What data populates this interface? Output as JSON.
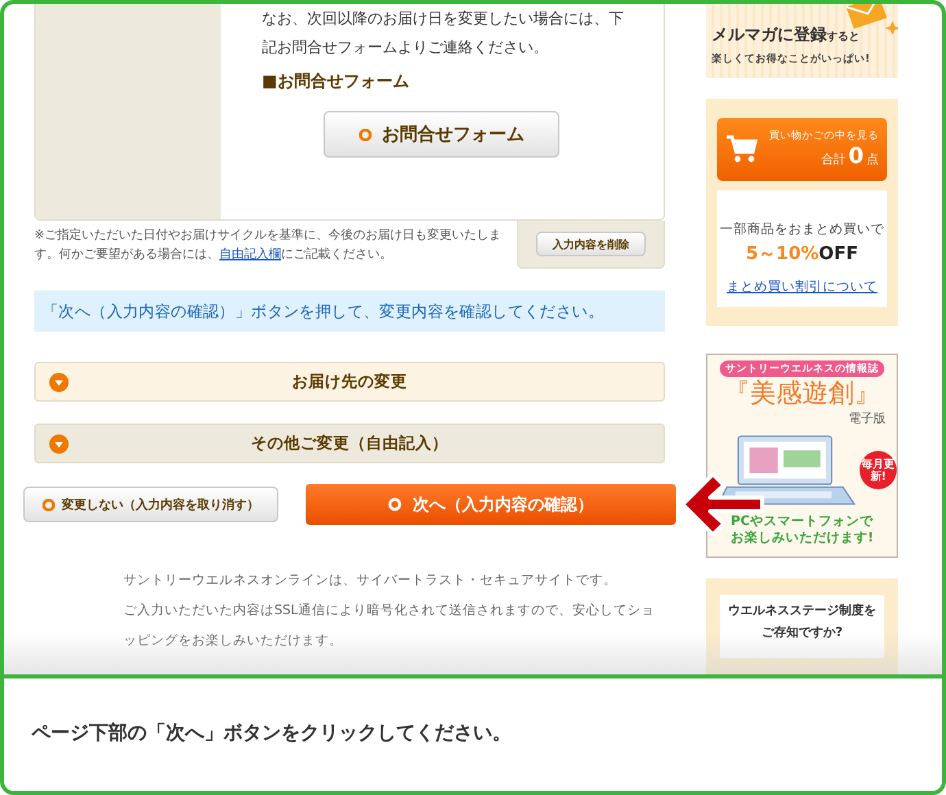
{
  "main": {
    "intro_text": "なお、次回以降のお届け日を変更したい場合には、下記お問合せフォームよりご連絡ください。",
    "form_heading": "■お問合せフォーム",
    "contact_button": "お問合せフォーム",
    "note": "※ご指定いただいた日付やお届けサイクルを基準に、今後のお届け日も変更いたします。何かご要望がある場合には、",
    "note_link": "自由記入欄",
    "note_end": "にご記載ください。",
    "delete_button": "入力内容を削除",
    "notice": "「次へ（入力内容の確認）」ボタンを押して、変更内容を確認してください。",
    "sections": [
      {
        "label": "お届け先の変更",
        "highlighted": true
      },
      {
        "label": "その他ご変更（自由記入）",
        "highlighted": false
      }
    ],
    "cancel_button": "変更しない（入力内容を取り消す）",
    "next_button": "次へ（入力内容の確認）",
    "secure_text": [
      "サントリーウエルネスオンラインは、サイバートラスト・セキュアサイトです。",
      "ご入力いただいた内容はSSL通信により暗号化されて送信されますので、安心してショッピングをお楽しみいただけます。"
    ]
  },
  "sidebar": {
    "newsletter": {
      "title": "メルマガに登録",
      "title_suffix": "すると",
      "subtitle": "楽しくてお得なことがいっぱい!"
    },
    "cart": {
      "label": "買い物かごの中を見る",
      "total_label": "合計",
      "count": "0",
      "unit": "点"
    },
    "discount": {
      "text": "一部商品をおまとめ買いで",
      "value": "5～10%",
      "suffix": "OFF",
      "link": "まとめ買い割引について"
    },
    "magazine": {
      "badge": "サントリーウエルネスの情報誌",
      "title": "『美感遊創』",
      "edition": "電子版",
      "stamp": "毎月更新!",
      "caption": "PCやスマートフォンでお楽しみいただけます!"
    },
    "wellness": {
      "title": "ウエルネスステージ制度をご存知ですか?"
    }
  },
  "instruction": "ページ下部の「次へ」ボタンをクリックしてください。"
}
